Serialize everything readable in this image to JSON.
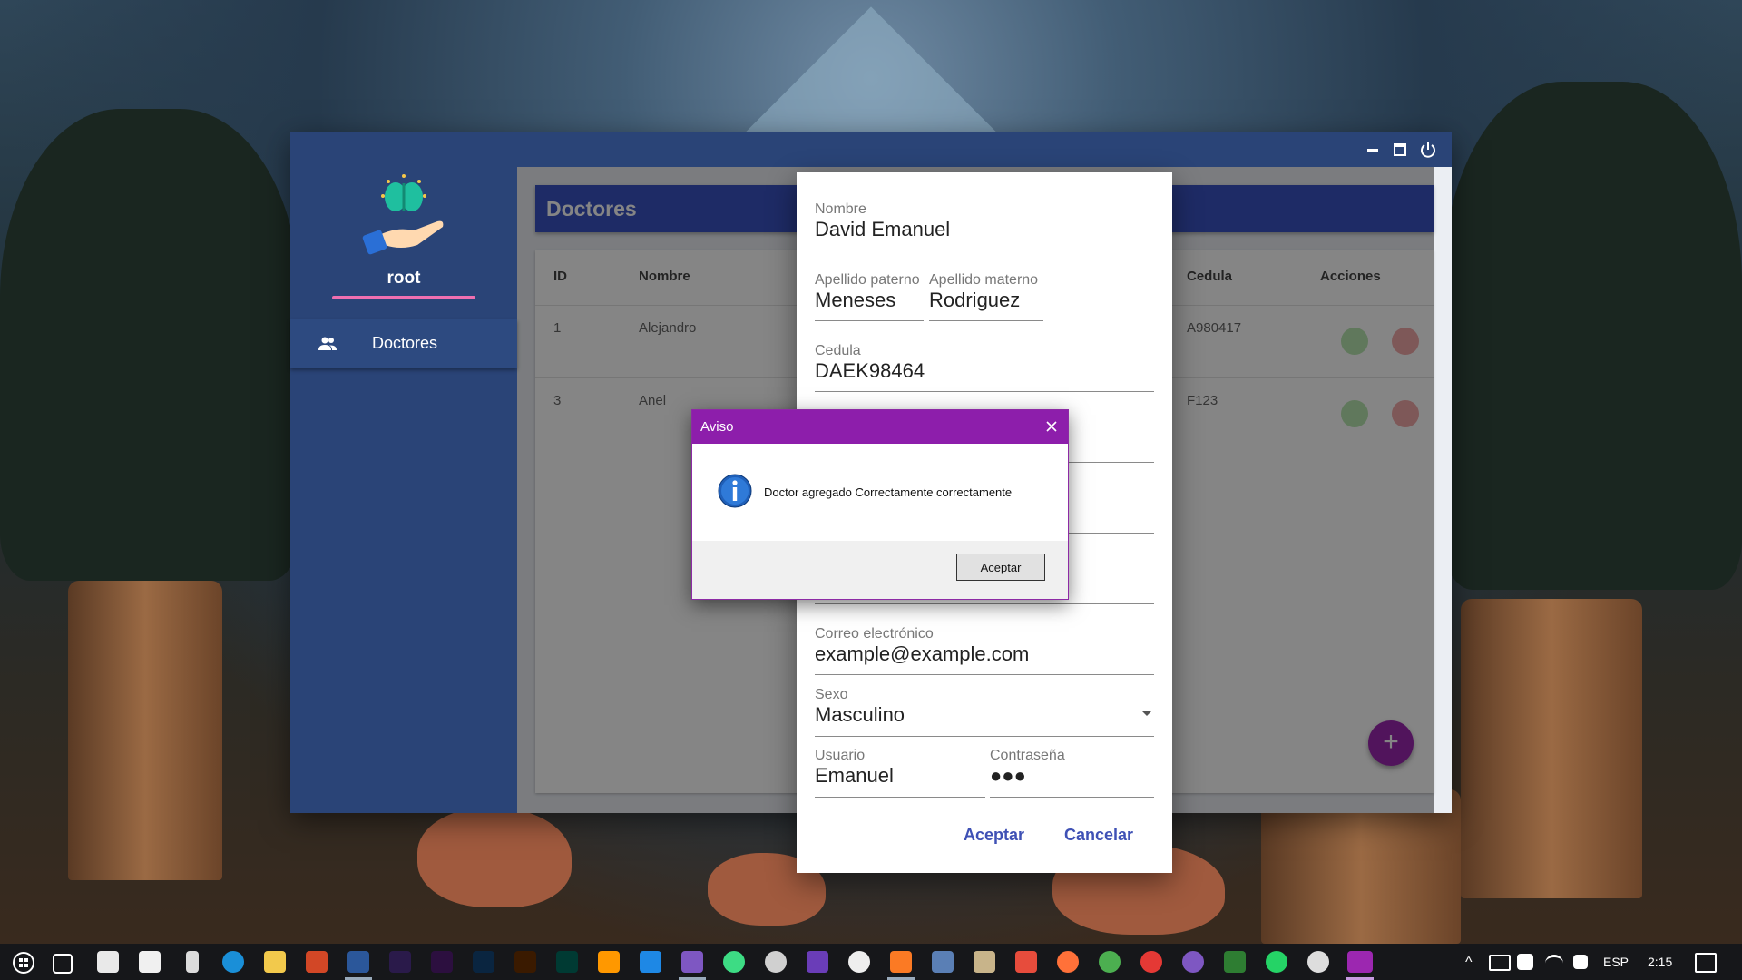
{
  "window": {
    "minimize_label": "minimize",
    "maximize_label": "maximize",
    "power_label": "power"
  },
  "sidebar": {
    "user_name": "root",
    "items": [
      {
        "label": "Doctores",
        "icon": "people-icon"
      }
    ]
  },
  "page": {
    "title": "Doctores",
    "table": {
      "headers": [
        "ID",
        "Nombre",
        "Cedula",
        "Acciones"
      ],
      "rows": [
        {
          "id": "1",
          "nombre": "Alejandro",
          "cedula": "A980417"
        },
        {
          "id": "3",
          "nombre": "Anel",
          "cedula": "F123"
        }
      ]
    },
    "fab_label": "+"
  },
  "form": {
    "nombre_label": "Nombre",
    "nombre_value": "David Emanuel",
    "ap_paterno_label": "Apellido paterno",
    "ap_paterno_value": "Meneses",
    "ap_materno_label": "Apellido materno",
    "ap_materno_value": "Rodriguez",
    "cedula_label": "Cedula",
    "cedula_value": "DAEK98464",
    "correo_label": "Correo electrónico",
    "correo_value": "example@example.com",
    "sexo_label": "Sexo",
    "sexo_value": "Masculino",
    "usuario_label": "Usuario",
    "usuario_value": "Emanuel",
    "password_label": "Contraseña",
    "password_value": "●●●",
    "accept_label": "Aceptar",
    "cancel_label": "Cancelar"
  },
  "message_box": {
    "title": "Aviso",
    "text": "Doctor agregado Correctamente correctamente",
    "ok_label": "Aceptar"
  },
  "taskbar": {
    "language": "ESP",
    "time": "2:15"
  },
  "colors": {
    "sidebar": "#2a4477",
    "header": "#3b53c4",
    "accent_pink": "#ef6fb0",
    "dialog_title": "#8d1eab",
    "button_text": "#3f51b5"
  }
}
